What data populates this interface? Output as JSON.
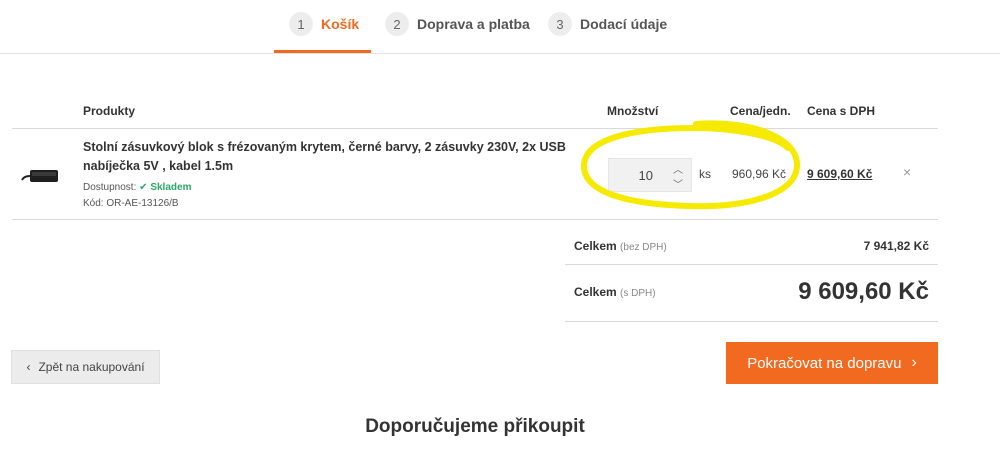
{
  "steps": [
    {
      "num": "1",
      "label": "Košík"
    },
    {
      "num": "2",
      "label": "Doprava a platba"
    },
    {
      "num": "3",
      "label": "Dodací údaje"
    }
  ],
  "table": {
    "col_products": "Produkty",
    "col_qty": "Množství",
    "col_unit_price": "Cena/jedn.",
    "col_price_vat": "Cena s DPH"
  },
  "item": {
    "title": "Stolní zásuvkový blok s frézovaným krytem, černé barvy, 2 zásuvky 230V, 2x USB nabíječka 5V , kabel 1.5m",
    "availability_label": "Dostupnost:",
    "availability_value": "Skladem",
    "code": "Kód: OR-AE-13126/B",
    "quantity": "10",
    "unit": "ks",
    "unit_price": "960,96 Kč",
    "total_price": "9 609,60 Kč",
    "remove_symbol": "×"
  },
  "totals": {
    "net_label": "Celkem",
    "net_sub": "(bez DPH)",
    "net_value": "7 941,82 Kč",
    "gross_label": "Celkem",
    "gross_sub": "(s DPH)",
    "gross_value": "9 609,60 Kč"
  },
  "actions": {
    "back_label": "Zpět na nakupování",
    "next_label": "Pokračovat na dopravu"
  },
  "recommend_title": "Doporučujeme přikoupit",
  "colors": {
    "accent": "#f26a1f",
    "available": "#2aa86a",
    "highlight": "#f5ea00"
  }
}
